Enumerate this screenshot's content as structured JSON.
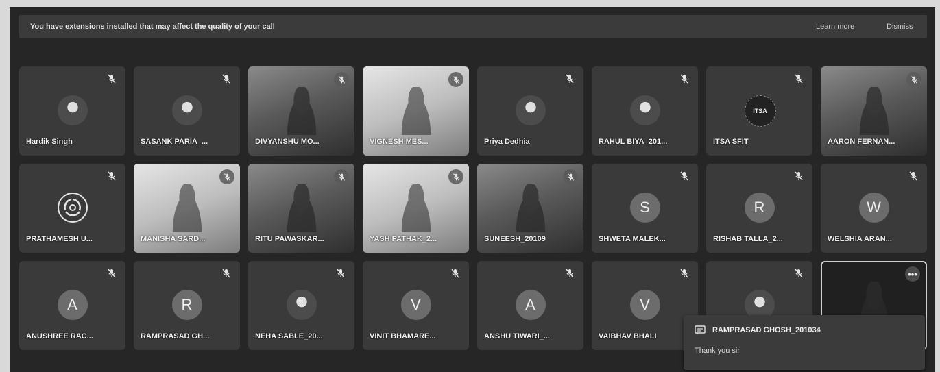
{
  "banner": {
    "message": "You have extensions installed that may affect the quality of your call",
    "learn_more": "Learn more",
    "dismiss": "Dismiss"
  },
  "participants": [
    {
      "name": "Hardik Singh",
      "kind": "photo-avatar",
      "muted": true
    },
    {
      "name": "SASANK PARIA_...",
      "kind": "photo-avatar",
      "muted": true
    },
    {
      "name": "DIVYANSHU MO...",
      "kind": "video",
      "muted": true
    },
    {
      "name": "VIGNESH MES...",
      "kind": "video-light",
      "muted": true
    },
    {
      "name": "Priya Dedhia",
      "kind": "photo-avatar",
      "muted": true
    },
    {
      "name": "RAHUL BIYA_201...",
      "kind": "photo-avatar",
      "muted": true
    },
    {
      "name": "ITSA SFIT",
      "kind": "text-logo",
      "initial": "ITSA",
      "muted": true
    },
    {
      "name": "AARON FERNAN...",
      "kind": "video",
      "muted": true
    },
    {
      "name": "PRATHAMESH U...",
      "kind": "logo-ring",
      "muted": true
    },
    {
      "name": "MANISHA SARD...",
      "kind": "video-light",
      "muted": true
    },
    {
      "name": "RITU PAWASKAR...",
      "kind": "video",
      "muted": true
    },
    {
      "name": "YASH PATHAK_2...",
      "kind": "video-light",
      "muted": true
    },
    {
      "name": "SUNEESH_20109",
      "kind": "video",
      "muted": true
    },
    {
      "name": "SHWETA MALEK...",
      "kind": "initial",
      "initial": "S",
      "muted": true
    },
    {
      "name": "RISHAB TALLA_2...",
      "kind": "initial",
      "initial": "R",
      "muted": true
    },
    {
      "name": "WELSHIA ARAN...",
      "kind": "initial",
      "initial": "W",
      "muted": true
    },
    {
      "name": "ANUSHREE RAC...",
      "kind": "initial",
      "initial": "A",
      "muted": true
    },
    {
      "name": "RAMPRASAD GH...",
      "kind": "initial",
      "initial": "R",
      "muted": true
    },
    {
      "name": "NEHA SABLE_20...",
      "kind": "photo-avatar",
      "muted": true
    },
    {
      "name": "VINIT BHAMARE...",
      "kind": "initial",
      "initial": "V",
      "muted": true
    },
    {
      "name": "ANSHU TIWARI_...",
      "kind": "initial",
      "initial": "A",
      "muted": true
    },
    {
      "name": "VAIBHAV BHALI",
      "kind": "initial",
      "initial": "V",
      "muted": true
    },
    {
      "name": "",
      "kind": "photo-avatar",
      "muted": true
    },
    {
      "name": "",
      "kind": "self-video",
      "muted": false,
      "more_label": "•••"
    }
  ],
  "chat_notification": {
    "sender": "RAMPRASAD GHOSH_201034",
    "message": "Thank you sir"
  },
  "colors": {
    "background": "#262626",
    "tile": "#3a3a3a",
    "banner": "#3b3b3b",
    "avatar": "#6c6c6c",
    "text": "#f2f2f2"
  }
}
